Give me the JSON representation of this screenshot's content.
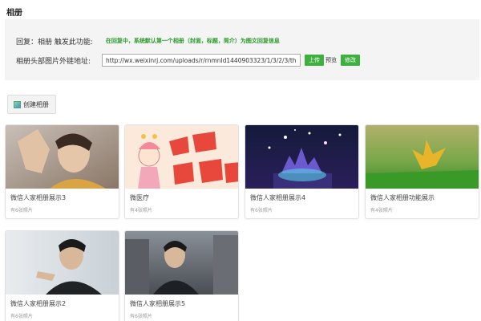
{
  "page": {
    "title": "相册"
  },
  "reply": {
    "label": "回复：相册 触发此功能:",
    "note": "在回复中，系统默认第一个相册（封面，标题，简介）为图文回复信息"
  },
  "cover": {
    "label": "相册头部图片外链地址:",
    "url_value": "http://wx.weixinrj.com/uploads/r/rnmnld1440903323/1/3/2/3/thumb_",
    "upload_label": "上传",
    "preview_label": "预览",
    "modify_label": "修改"
  },
  "toolbar": {
    "create_label": "创建相册"
  },
  "albums": [
    {
      "name": "微信人家相册展示3",
      "count": "有6张照片"
    },
    {
      "name": "微医疗",
      "count": "有4张照片"
    },
    {
      "name": "微信人家相册展示4",
      "count": "有6张照片"
    },
    {
      "name": "微信人家相册功能展示",
      "count": "有4张照片"
    },
    {
      "name": "微信人家相册展示2",
      "count": "有6张照片"
    },
    {
      "name": "微信人家相册展示5",
      "count": "有6张照片"
    }
  ],
  "colors": {
    "accent_green": "#3faf3f",
    "note_green": "#2a9a2a",
    "panel_bg": "#f4f4f4"
  }
}
